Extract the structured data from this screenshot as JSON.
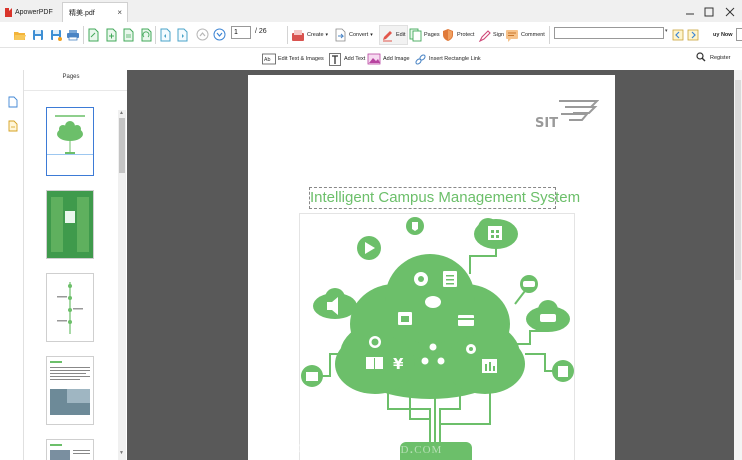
{
  "app": {
    "name": "ApowerPDF"
  },
  "tab": {
    "title": "精美.pdf",
    "close": "×"
  },
  "toolbar": {
    "page_current": "1",
    "page_total": "/ 26",
    "create": "Create",
    "convert": "Convert",
    "edit": "Edit",
    "pages": "Pages",
    "protect": "Protect",
    "sign": "Sign",
    "comment": "Comment",
    "search_value": "",
    "buy_now": "uy Now"
  },
  "subtoolbar": {
    "edit_text_images": "Edit Text & Images",
    "add_text": "Add Text",
    "add_image": "Add Image",
    "insert_rect_link": "Insert Rectangle Link",
    "register": "Register"
  },
  "sidebar": {
    "title": "Pages"
  },
  "document": {
    "title": "Intelligent Campus Management System",
    "logo_text": "SIT"
  },
  "watermark": "GearDownload.com",
  "colors": {
    "accent_green": "#6cbf6a",
    "dark_green": "#3f9a4c",
    "canvas_gray": "#595959",
    "selection_blue": "#3d7bd6"
  },
  "icons": [
    "open-folder-icon",
    "save-icon",
    "save-as-icon",
    "print-icon",
    "page-first-icon",
    "add-page-icon",
    "page-icon",
    "rotate-page-icon",
    "page-prev-icon",
    "page-next-icon",
    "arrow-up-icon",
    "arrow-down-icon",
    "create-icon",
    "convert-icon",
    "edit-icon",
    "pages-icon",
    "protect-icon",
    "sign-icon",
    "comment-icon",
    "search-prev-icon",
    "search-next-icon",
    "edit-text-images-icon",
    "add-text-icon",
    "add-image-icon",
    "link-icon",
    "search-icon"
  ]
}
